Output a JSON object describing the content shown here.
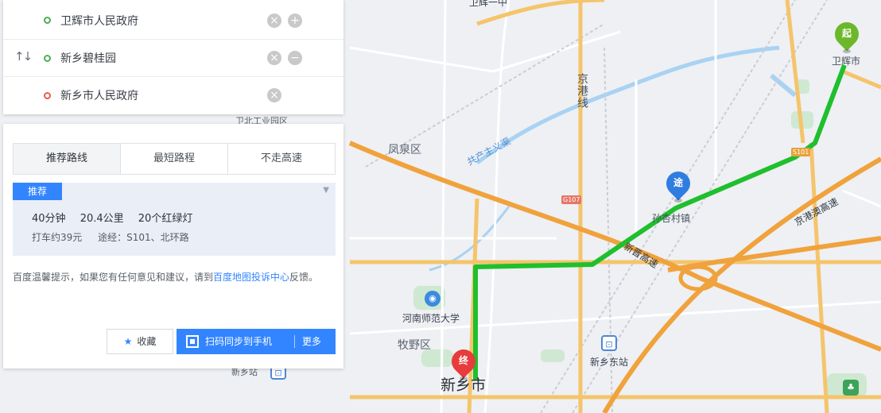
{
  "waypoints": [
    {
      "name": "卫辉市人民政府",
      "type": "start",
      "action": "add"
    },
    {
      "name": "新乡碧桂园",
      "type": "via",
      "action": "remove"
    },
    {
      "name": "新乡市人民政府",
      "type": "end",
      "action": "none"
    }
  ],
  "tabs": [
    "推荐路线",
    "最短路程",
    "不走高速"
  ],
  "route": {
    "badge": "推荐",
    "duration": "40分钟",
    "distance": "20.4公里",
    "lights": "20个红绿灯",
    "taxi": "打车约39元",
    "via": "途经：S101、北环路"
  },
  "feedback": {
    "text1": "百度温馨提示，如果您有任何意见和建议，请到",
    "link": "百度地图投诉中心",
    "text2": "反馈。"
  },
  "buttons": {
    "favorite": "收藏",
    "sync": "扫码同步到手机",
    "more": "更多"
  },
  "map": {
    "labels": {
      "weihui": "卫辉市",
      "industrial": "卫北工业园区",
      "fengquan": "凤泉区",
      "river": "共产主义渠",
      "jinggang_road": "京港线",
      "town": "孙杏村镇",
      "university": "河南师范大学",
      "muye": "牧野区",
      "xinxiang": "新乡市",
      "xinxiang_station": "新乡站",
      "east_station": "新乡东站",
      "expressway_1": "新晋高速",
      "expressway_2": "京港澳高速",
      "top_poi": "卫辉一中"
    },
    "shields": {
      "s101": "S101",
      "g107": "G107"
    },
    "pins": {
      "start": "起",
      "via": "途",
      "end": "终"
    },
    "colors": {
      "route": "#1fbf2d",
      "major_road": "#f5c46b",
      "expressway": "#f0a23c",
      "water": "#a9d2f3",
      "park": "#cfe8d2"
    }
  }
}
